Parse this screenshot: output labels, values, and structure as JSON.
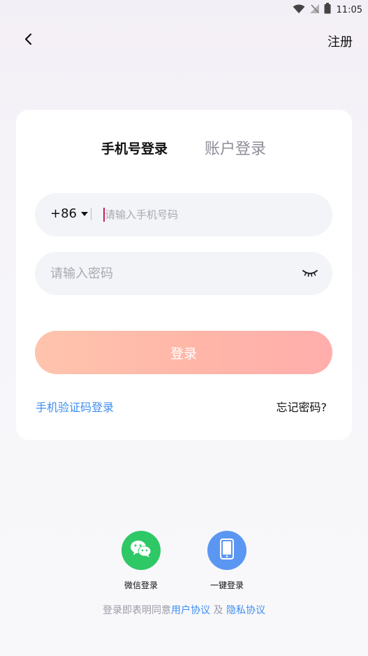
{
  "status_bar": {
    "time": "11:05"
  },
  "topbar": {
    "register": "注册"
  },
  "tabs": {
    "active": "手机号登录",
    "inactive": "账户登录"
  },
  "phone": {
    "country_code": "+86",
    "placeholder": "请输入手机号码",
    "value": ""
  },
  "password": {
    "placeholder": "请输入密码",
    "value": ""
  },
  "buttons": {
    "login": "登录"
  },
  "links": {
    "sms_login": "手机验证码登录",
    "forgot_password": "忘记密码?"
  },
  "social": {
    "wechat": "微信登录",
    "onekey": "一键登录"
  },
  "agreement": {
    "prefix": "登录即表明同意",
    "user_agreement": "用户协议",
    "and": " 及 ",
    "privacy": "隐私协议"
  },
  "colors": {
    "accent": "#3f8ff0",
    "login_gradient_start": "#ffc4ad",
    "login_gradient_end": "#ffaeac",
    "wechat": "#2ec866",
    "onekey": "#5b96f2"
  },
  "icons": {
    "back": "chevron-left-icon",
    "eye_toggle": "eye-closed-icon",
    "wechat": "wechat-icon",
    "onekey": "phone-icon",
    "wifi": "wifi-icon",
    "signal": "signal-off-icon",
    "battery": "battery-icon"
  }
}
